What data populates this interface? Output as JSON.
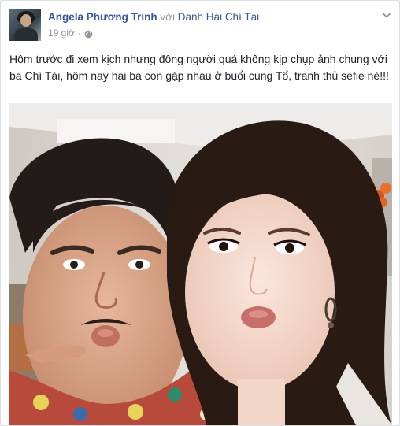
{
  "post": {
    "author": "Angela Phương Trinh",
    "with_text": "với",
    "tagged": "Danh Hài Chí Tài",
    "time": "19 giờ",
    "separator": "·",
    "privacy_icon": "globe-icon",
    "menu_icon": "chevron-down-icon",
    "text": "Hôm trước đi xem kịch nhưng đông người quá không kịp chụp ảnh chung với ba Chí Tài, hôm nay hai ba con gặp nhau ở buổi cúng Tổ, tranh thủ sefie nè!!!"
  },
  "colors": {
    "link": "#365899",
    "meta": "#90949c",
    "text": "#1d2129"
  }
}
